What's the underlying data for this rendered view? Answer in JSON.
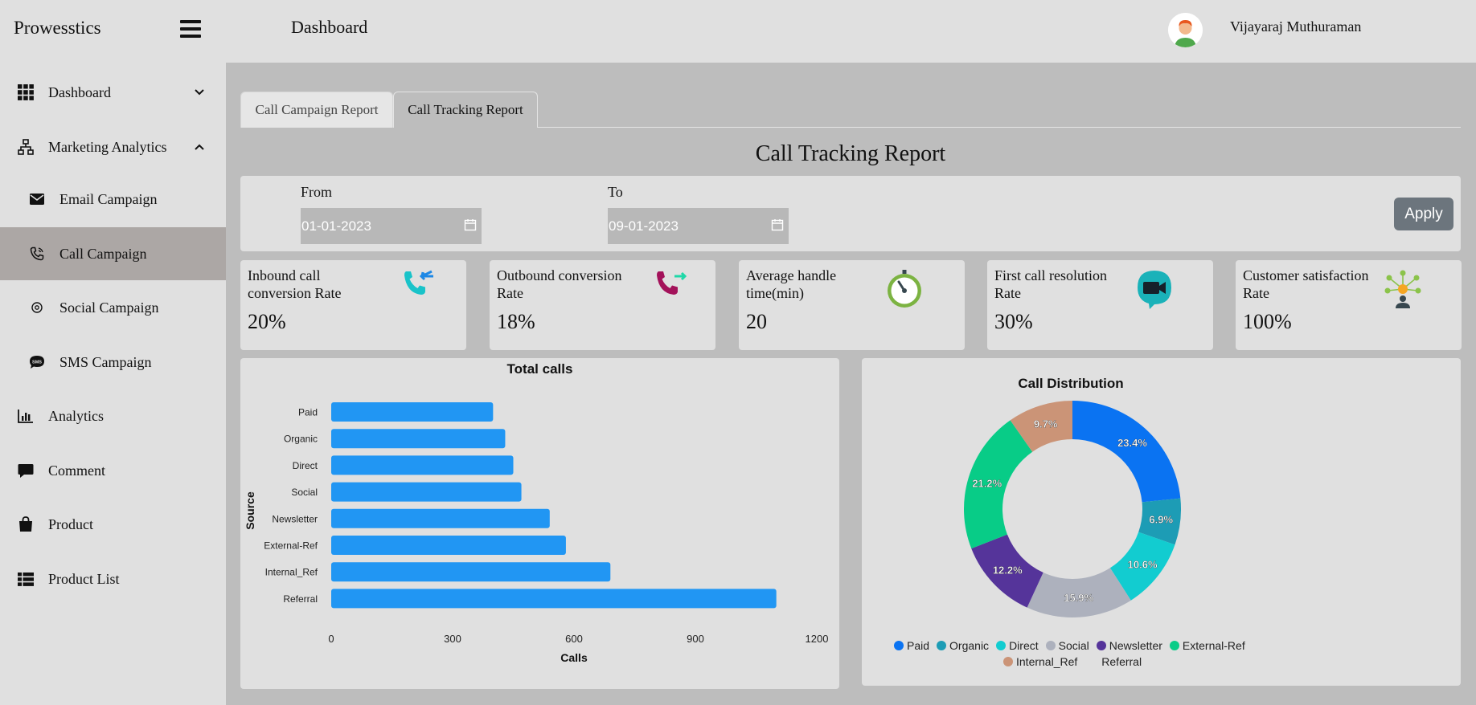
{
  "app": {
    "brand": "Prowesstics",
    "page_heading": "Dashboard",
    "user_name": "Vijayaraj Muthuraman"
  },
  "sidebar": {
    "items": [
      {
        "label": "Dashboard",
        "icon": "grid-icon"
      },
      {
        "label": "Marketing Analytics",
        "icon": "sitemap-icon"
      },
      {
        "label": "Email Campaign",
        "icon": "envelope-icon"
      },
      {
        "label": "Call Campaign",
        "icon": "phone-icon"
      },
      {
        "label": "Social Campaign",
        "icon": "at-sign-icon"
      },
      {
        "label": "SMS Campaign",
        "icon": "sms-bubble-icon"
      },
      {
        "label": "Analytics",
        "icon": "bar-chart-icon"
      },
      {
        "label": "Comment",
        "icon": "comment-icon"
      },
      {
        "label": "Product",
        "icon": "shopping-bag-icon"
      },
      {
        "label": "Product List",
        "icon": "list-icon"
      }
    ],
    "active": "Call Campaign"
  },
  "tabs": [
    {
      "label": "Call Campaign Report"
    },
    {
      "label": "Call Tracking Report"
    }
  ],
  "active_tab": "Call Tracking Report",
  "report": {
    "title": "Call Tracking Report",
    "from_label": "From",
    "from_value": "01-01-2023",
    "to_label": "To",
    "to_value": "09-01-2023",
    "apply_label": "Apply"
  },
  "kpis": [
    {
      "title": "Inbound call conversion Rate",
      "value": "20%",
      "icon": "incoming-call-icon"
    },
    {
      "title": "Outbound conversion Rate",
      "value": "18%",
      "icon": "outgoing-call-icon"
    },
    {
      "title": "Average handle time(min)",
      "value": "20",
      "icon": "stopwatch-icon"
    },
    {
      "title": "First call resolution Rate",
      "value": "30%",
      "icon": "video-chat-icon"
    },
    {
      "title": "Customer satisfaction Rate",
      "value": "100%",
      "icon": "network-people-icon"
    }
  ],
  "colors": {
    "bar": "#2196f3",
    "active_nav": "#aca7a5",
    "apply_button": "#6c757d"
  },
  "chart_data": [
    {
      "type": "bar",
      "orientation": "horizontal",
      "title": "Total calls",
      "xlabel": "Calls",
      "ylabel": "Source",
      "categories": [
        "Paid",
        "Organic",
        "Direct",
        "Social",
        "Newsletter",
        "External-Ref",
        "Internal_Ref",
        "Referral"
      ],
      "values": [
        400,
        430,
        450,
        470,
        540,
        580,
        690,
        1100
      ],
      "xlim": [
        0,
        1200
      ],
      "xticks": [
        "0",
        "300",
        "600",
        "900",
        "1200"
      ],
      "grid": false,
      "color": "#2196f3"
    },
    {
      "type": "pie",
      "donut": true,
      "title": "Call Distribution",
      "series": [
        {
          "name": "Paid",
          "value": 23.4,
          "label": "23.4%",
          "color": "#0a73f2"
        },
        {
          "name": "Organic",
          "value": 6.9,
          "label": "6.9%",
          "color": "#1d9cb5"
        },
        {
          "name": "Direct",
          "value": 10.6,
          "label": "10.6%",
          "color": "#12ccd0"
        },
        {
          "name": "Social",
          "value": 15.9,
          "label": "15.9%",
          "color": "#adb1bd"
        },
        {
          "name": "Newsletter",
          "value": 12.2,
          "label": "12.2%",
          "color": "#55349a"
        },
        {
          "name": "External-Ref",
          "value": 21.2,
          "label": "21.2%",
          "color": "#08cc87"
        },
        {
          "name": "Internal_Ref",
          "value": 9.7,
          "label": "9.7%",
          "color": "#cb9477"
        },
        {
          "name": "Referral",
          "value": 0,
          "color": "#e0e0e0"
        }
      ],
      "legend_position": "bottom"
    }
  ]
}
